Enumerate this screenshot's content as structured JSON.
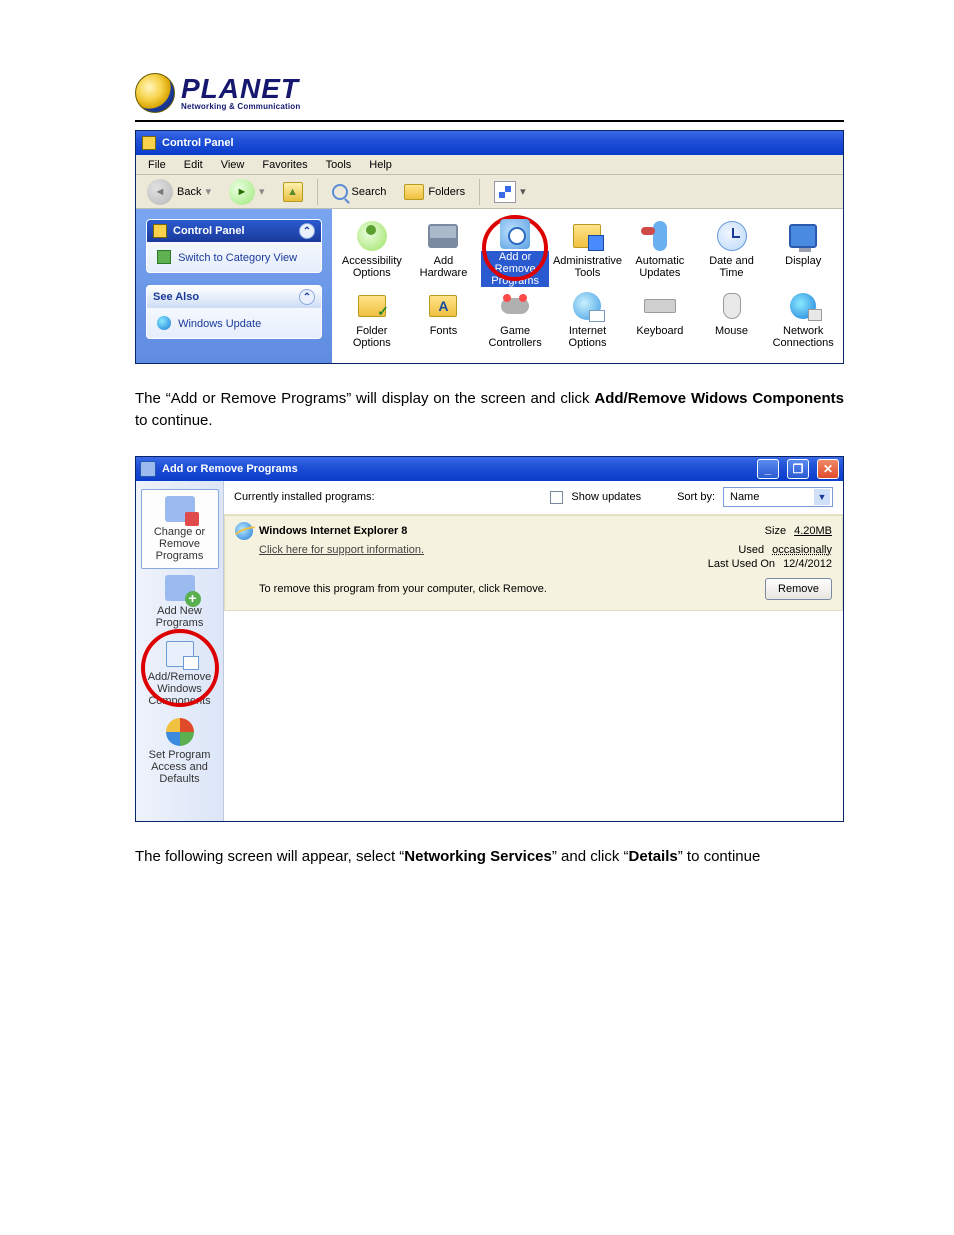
{
  "logo": {
    "name": "PLANET",
    "tagline": "Networking & Communication"
  },
  "para1": {
    "pre": "The “Add or Remove Programs” will display on the screen and click ",
    "bold": "Add/Remove Widows Components",
    "post": " to continue."
  },
  "para2": {
    "pre": "The following screen will appear, select “",
    "b1": "Networking Services",
    "mid": "” and click “",
    "b2": "Details",
    "post": "” to continue"
  },
  "win1": {
    "title": "Control Panel",
    "menu": [
      "File",
      "Edit",
      "View",
      "Favorites",
      "Tools",
      "Help"
    ],
    "tb": {
      "back": "Back",
      "search": "Search",
      "folders": "Folders"
    },
    "sidebar": {
      "head1": "Control Panel",
      "switch": "Switch to Category View",
      "head2": "See Also",
      "wu": "Windows Update"
    },
    "items": [
      {
        "label": "Accessibility Options"
      },
      {
        "label": "Add Hardware"
      },
      {
        "label": "Add or Remove Programs",
        "selected": true,
        "circled": true
      },
      {
        "label": "Administrative Tools"
      },
      {
        "label": "Automatic Updates"
      },
      {
        "label": "Date and Time"
      },
      {
        "label": "Display"
      },
      {
        "label": "Folder Options"
      },
      {
        "label": "Fonts"
      },
      {
        "label": "Game Controllers"
      },
      {
        "label": "Internet Options"
      },
      {
        "label": "Keyboard"
      },
      {
        "label": "Mouse"
      },
      {
        "label": "Network Connections"
      }
    ]
  },
  "win2": {
    "title": "Add or Remove Programs",
    "leftbtns": [
      {
        "label": "Change or Remove Programs"
      },
      {
        "label": "Add New Programs"
      },
      {
        "label": "Add/Remove Windows Components",
        "circled": true
      },
      {
        "label": "Set Program Access and Defaults"
      }
    ],
    "top": {
      "installed": "Currently installed programs:",
      "showupd": "Show updates",
      "sortby": "Sort by:",
      "sortval": "Name"
    },
    "prog": {
      "name": "Windows Internet Explorer 8",
      "supportlink": "Click here for support information.",
      "size_lbl": "Size",
      "size_val": "4.20MB",
      "used_lbl": "Used",
      "used_val": "occasionally",
      "last_lbl": "Last Used On",
      "last_val": "12/4/2012",
      "removemsg": "To remove this program from your computer, click Remove.",
      "removebtn": "Remove"
    }
  }
}
